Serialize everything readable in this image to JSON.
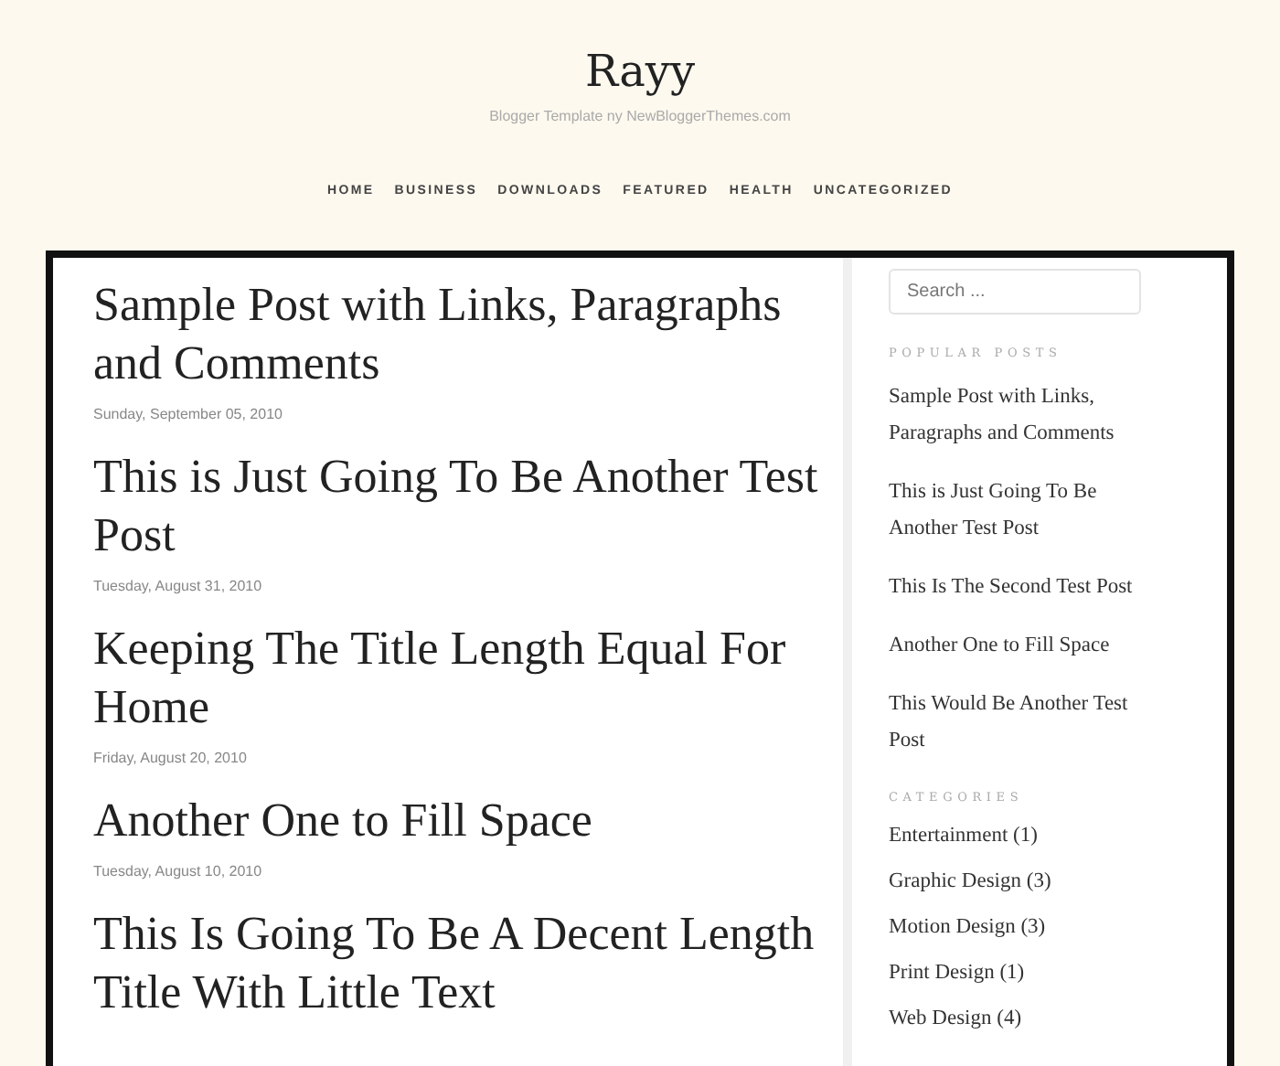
{
  "site": {
    "title": "Rayy",
    "tagline": "Blogger Template ny NewBloggerThemes.com"
  },
  "nav": [
    "HOME",
    "BUSINESS",
    "DOWNLOADS",
    "FEATURED",
    "HEALTH",
    "UNCATEGORIZED"
  ],
  "posts": [
    {
      "title": "Sample Post with Links, Paragraphs and Comments",
      "date": "Sunday, September 05, 2010"
    },
    {
      "title": "This is Just Going To Be Another Test Post",
      "date": "Tuesday, August 31, 2010"
    },
    {
      "title": "Keeping The Title Length Equal For Home",
      "date": "Friday, August 20, 2010"
    },
    {
      "title": "Another One to Fill Space",
      "date": "Tuesday, August 10, 2010"
    },
    {
      "title": "This Is Going To Be A Decent Length Title With Little Text"
    }
  ],
  "sidebar": {
    "search": {
      "placeholder": "Search ..."
    },
    "popular_heading": "POPULAR POSTS",
    "popular_posts": [
      "Sample Post with Links, Paragraphs and Comments",
      "This is Just Going To Be Another Test Post",
      "This Is The Second Test Post",
      "Another One to Fill Space",
      "This Would Be Another Test Post"
    ],
    "categories_heading": "CATEGORIES",
    "categories": [
      "Entertainment (1)",
      "Graphic Design (3)",
      "Motion Design (3)",
      "Print Design (1)",
      "Web Design (4)"
    ]
  }
}
